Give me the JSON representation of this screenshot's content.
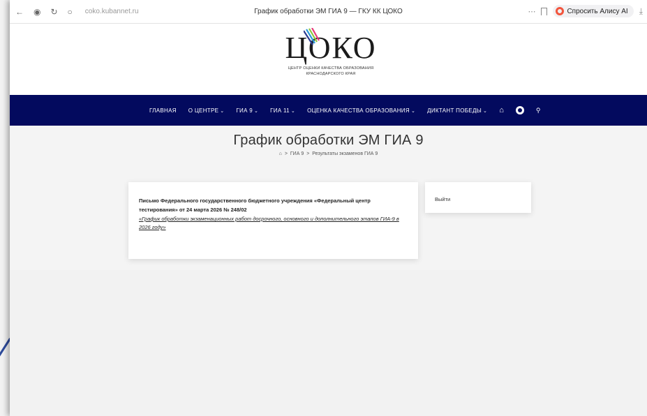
{
  "browser": {
    "url": "coko.kubannet.ru",
    "tab_title": "График обработки ЭМ ГИА 9 — ГКУ КК ЦОКО",
    "alice_label": "Спросить Алису AI",
    "more_icon": "ellipsis-icon",
    "bookmark_icon": "bookmark-icon",
    "download_icon": "download-icon"
  },
  "logo": {
    "word": "ЦОКО",
    "subtitle_line1": "ЦЕНТР ОЦЕНКИ КАЧЕСТВА ОБРАЗОВАНИЯ",
    "subtitle_line2": "КРАСНОДАРСКОГО КРАЯ"
  },
  "nav": {
    "items": [
      {
        "label": "ГЛАВНАЯ",
        "dropdown": false
      },
      {
        "label": "О ЦЕНТРЕ",
        "dropdown": true
      },
      {
        "label": "ГИА 9",
        "dropdown": true
      },
      {
        "label": "ГИА 11",
        "dropdown": true
      },
      {
        "label": "ОЦЕНКА КАЧЕСТВА ОБРАЗОВАНИЯ",
        "dropdown": true
      },
      {
        "label": "ДИКТАНТ ПОБЕДЫ",
        "dropdown": true
      }
    ],
    "chevron": "⌄",
    "icons": [
      "home-icon",
      "accessibility-icon",
      "search-icon"
    ]
  },
  "page": {
    "title": "График обработки ЭМ ГИА 9",
    "breadcrumb": [
      "ГИА 9",
      "Результаты экзаменов ГИА 9"
    ],
    "breadcrumb_sep": ">"
  },
  "main_card": {
    "text": "Письмо Федерального государственного бюджетного учреждения «Федеральный центр тестирования» от 24 марта 2026 № 248/02",
    "link": "«График обработки экзаменационных работ досрочного, основного и дополнительного этапов ГИА-9 в 2026 году»"
  },
  "side_card": {
    "logout": "Выйти"
  },
  "colors": {
    "navbar": "#030a5e",
    "alice_ring": "#f2553d"
  }
}
